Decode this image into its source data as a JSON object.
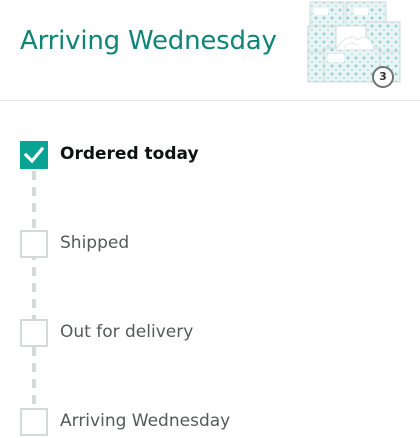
{
  "header": {
    "title": "Arriving Wednesday",
    "product_image_icon": "tissue-box-pack-image",
    "quantity": "3"
  },
  "colors": {
    "accent": "#0f8578",
    "check_fill": "#0aa393",
    "divider": "#e3e6e6",
    "inactive_box": "#d5d9d9"
  },
  "steps": [
    {
      "label": "Ordered today",
      "done": true
    },
    {
      "label": "Shipped",
      "done": false
    },
    {
      "label": "Out for delivery",
      "done": false
    },
    {
      "label": "Arriving Wednesday",
      "done": false
    }
  ]
}
